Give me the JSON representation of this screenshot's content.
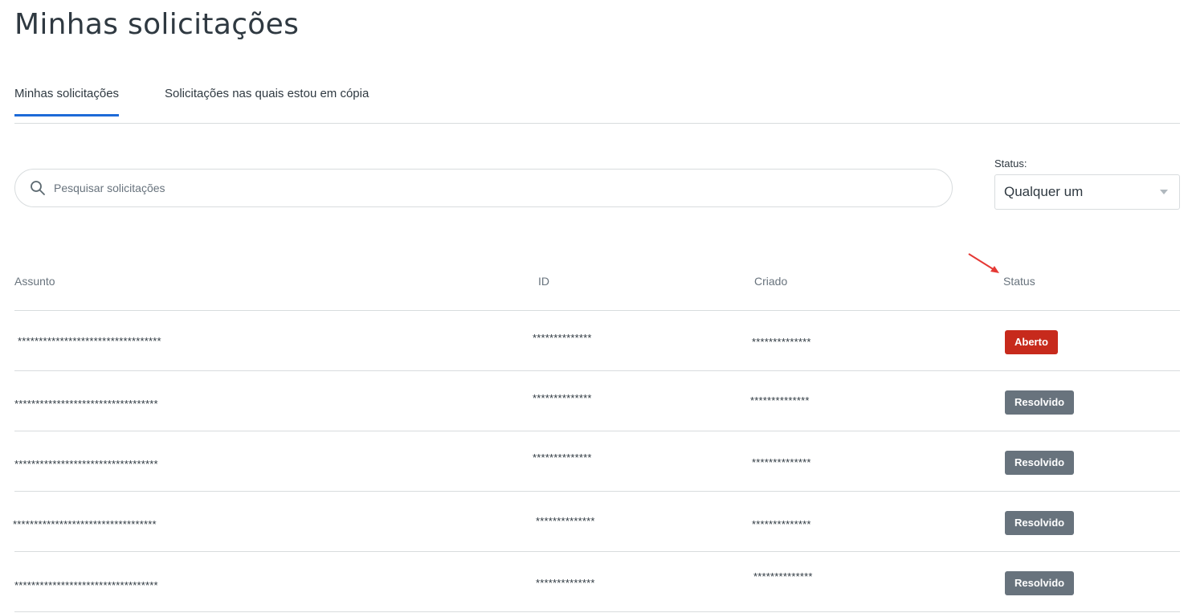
{
  "page": {
    "title": "Minhas solicitações"
  },
  "tabs": [
    {
      "label": "Minhas solicitações",
      "active": true
    },
    {
      "label": "Solicitações nas quais estou em cópia",
      "active": false
    }
  ],
  "search": {
    "placeholder": "Pesquisar solicitações",
    "value": ""
  },
  "status_filter": {
    "label": "Status:",
    "selected": "Qualquer um"
  },
  "table": {
    "columns": {
      "subject": "Assunto",
      "id": "ID",
      "created": "Criado",
      "status": "Status"
    },
    "rows": [
      {
        "subject": "**********************************",
        "id": "**************",
        "created": "**************",
        "status": "Aberto"
      },
      {
        "subject": "**********************************",
        "id": "**************",
        "created": "**************",
        "status": "Resolvido"
      },
      {
        "subject": "**********************************",
        "id": "**************",
        "created": "**************",
        "status": "Resolvido"
      },
      {
        "subject": "**********************************",
        "id": "**************",
        "created": "**************",
        "status": "Resolvido"
      },
      {
        "subject": "**********************************",
        "id": "**************",
        "created": "**************",
        "status": "Resolvido"
      }
    ]
  },
  "colors": {
    "tab_active_underline": "#1d6ad8",
    "status_open": "#c72a1c",
    "status_resolved": "#68737d",
    "annotation_arrow": "#e53935"
  },
  "icons": {
    "search": "search-icon",
    "dropdown": "chevron-down-icon",
    "annotation": "arrow-annotation-icon"
  }
}
